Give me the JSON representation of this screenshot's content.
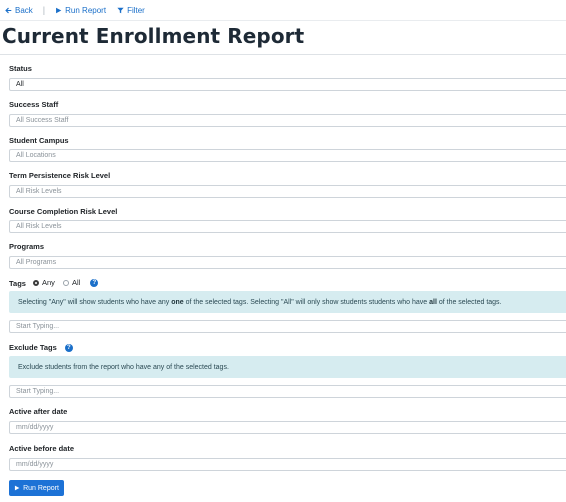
{
  "toolbar": {
    "back_label": "Back",
    "run_label": "Run Report",
    "filter_label": "Filter"
  },
  "page_title": "Current Enrollment Report",
  "status": {
    "label": "Status",
    "value": "All"
  },
  "success_staff": {
    "label": "Success Staff",
    "placeholder": "All Success Staff"
  },
  "student_campus": {
    "label": "Student Campus",
    "placeholder": "All Locations"
  },
  "term_risk": {
    "label": "Term Persistence Risk Level",
    "placeholder": "All Risk Levels"
  },
  "course_risk": {
    "label": "Course Completion Risk Level",
    "placeholder": "All Risk Levels"
  },
  "programs": {
    "label": "Programs",
    "placeholder": "All Programs"
  },
  "tags": {
    "label": "Tags",
    "option_any": "Any",
    "option_all": "All",
    "selected": "Any",
    "help": "?",
    "alert_part1": "Selecting \"Any\" will show students who have any ",
    "alert_bold1": "one",
    "alert_part2": " of the selected tags. Selecting \"All\" will only show students students who have ",
    "alert_bold2": "all",
    "alert_part3": " of the selected tags.",
    "placeholder": "Start Typing..."
  },
  "exclude_tags": {
    "label": "Exclude Tags",
    "help": "?",
    "alert": "Exclude students from the report who have any of the selected tags.",
    "placeholder": "Start Typing..."
  },
  "active_after": {
    "label": "Active after date",
    "placeholder": "mm/dd/yyyy"
  },
  "active_before": {
    "label": "Active before date",
    "placeholder": "mm/dd/yyyy"
  },
  "run_button": {
    "label": "Run Report"
  },
  "colors": {
    "accent": "#1d72d6",
    "alert_bg": "#d6ecf0",
    "link": "#1a6fc9"
  },
  "icons": {
    "back": "arrow-left-icon",
    "run": "play-icon",
    "filter": "filter-icon",
    "help": "question-circle-icon"
  }
}
